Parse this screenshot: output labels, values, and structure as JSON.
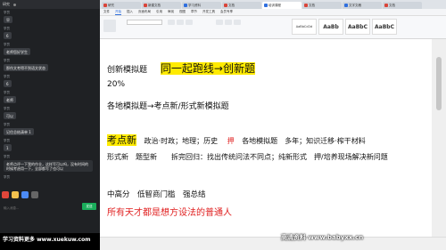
{
  "chat": {
    "title": "研究",
    "messages": [
      {
        "name": "学员",
        "text": "早"
      },
      {
        "name": "学员",
        "text": "6"
      },
      {
        "name": "学员",
        "text": "老师您好学生"
      },
      {
        "name": "学员",
        "text": "那作文考得不到语文状态"
      },
      {
        "name": "学员",
        "text": "6"
      },
      {
        "name": "学员",
        "text": "老师"
      },
      {
        "name": "学员",
        "text": "可以"
      },
      {
        "name": "学员",
        "text": "记住总结清单 1"
      },
      {
        "name": "学员",
        "text": "1"
      },
      {
        "name": "学员",
        "text": "老师点评一下我的作业，这样写可以吗，没有时间的时候考虑用一下，全部都写了也可以"
      },
      {
        "name": "学员",
        "text": "1"
      },
      {
        "name": "学员",
        "text": "5"
      }
    ],
    "input_hint": "输入消息...",
    "send_label": "发送"
  },
  "browser": {
    "tabs": [
      "研究",
      "新建文档",
      "学习资料",
      "文档",
      "培训课程",
      "文档",
      "文字文稿",
      "文档"
    ],
    "active_tab": 4
  },
  "menu": {
    "items": [
      "文件",
      "开始",
      "插入",
      "页面布局",
      "引用",
      "审阅",
      "视图",
      "章节",
      "开发工具",
      "会员专享"
    ],
    "active": 1
  },
  "ribbon": {
    "styles": [
      "AaBbCcDd",
      "AaBb",
      "AaBbC",
      "AaBbC"
    ]
  },
  "document": {
    "line1_a": "创新模拟题",
    "line1_b": "同一起跑线→创新题",
    "line2": "20%",
    "line3": "各地模拟题→考点新/形式新模拟题",
    "line4_a": "考点新",
    "line4_b": "政治·时政；地理；历史",
    "line4_c": "押",
    "line4_d": "各地模拟题　多年；知识迁移·榨干材料",
    "line5": "形式新　题型新　　拆完回归：找出传统问法不同点；纯新形式　押/培养现场解决新问题",
    "line6": "中高分　低智商门槛　强总结",
    "line7": "所有天才都是想方设法的普通人"
  },
  "watermark": {
    "left": "学习资料更多 www.xuekuw.com",
    "right": "高清资料 www.babyxx.cn"
  }
}
